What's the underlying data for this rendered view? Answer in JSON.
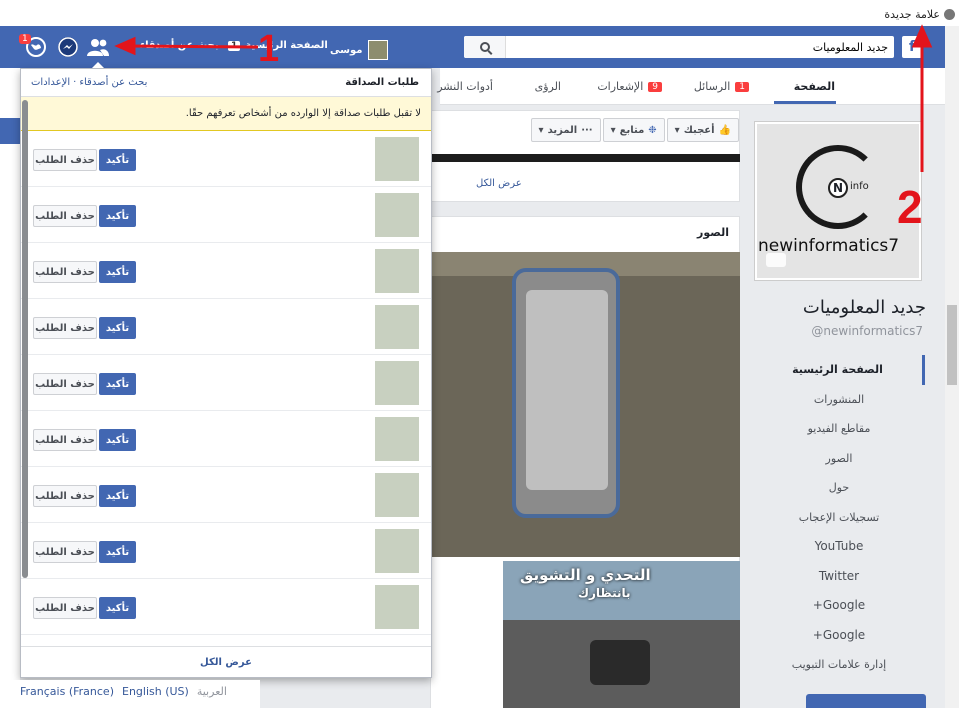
{
  "browser": {
    "bookmark_label": "علامة جديدة"
  },
  "topbar": {
    "logo": "f",
    "search_value": "جديد المعلوميات",
    "user_name": "موسى",
    "home_label": "الصفحة الرئيسية",
    "home_count": "1",
    "find_friends_label": "بحث عن أصدقاء",
    "notification_count": "1"
  },
  "page": {
    "name": "جديد المعلوميات",
    "handle": "@newinformatics7",
    "logo_letter": "N",
    "logo_suffix": "info",
    "logo_caption": "newinformatics7",
    "tabs": [
      {
        "label": "الصفحة"
      },
      {
        "label": "الرسائل",
        "badge": "1"
      },
      {
        "label": "الإشعارات",
        "badge": "9"
      },
      {
        "label": "الرؤى"
      },
      {
        "label": "أدوات النشر"
      }
    ],
    "actions": {
      "like": "أعجبك",
      "follow": "متابع",
      "more": "المزيد"
    },
    "view_all_label": "عرض الكل",
    "photos_title": "الصور",
    "game_title": "التحدي و التشويق",
    "game_subtitle": "بانتظارك",
    "nav": [
      "الصفحة الرئيسية",
      "المنشورات",
      "مقاطع الفيديو",
      "الصور",
      "حول",
      "تسجيلات الإعجاب",
      "YouTube",
      "Twitter",
      "Google+",
      "Google+",
      "إدارة علامات التبويب"
    ]
  },
  "friend_requests": {
    "title": "طلبات الصداقة",
    "find_friends_link": "بحث عن أصدقاء",
    "separator": "·",
    "settings_link": "الإعدادات",
    "notice": "لا تقبل طلبات صداقة إلا الوارده من أشخاص تعرفهم حقًا.",
    "confirm_label": "تأكيد",
    "delete_label": "حذف الطلب",
    "rows": 9,
    "view_all": "عرض الكل"
  },
  "footer": {
    "languages": [
      "العربية",
      "English (US)",
      "Français (France)"
    ]
  },
  "annotations": {
    "one": "1",
    "two": "2"
  },
  "colors": {
    "fb_blue": "#4267b2",
    "annotation_red": "#e3141b",
    "notice_yellow": "#fff9d7"
  }
}
